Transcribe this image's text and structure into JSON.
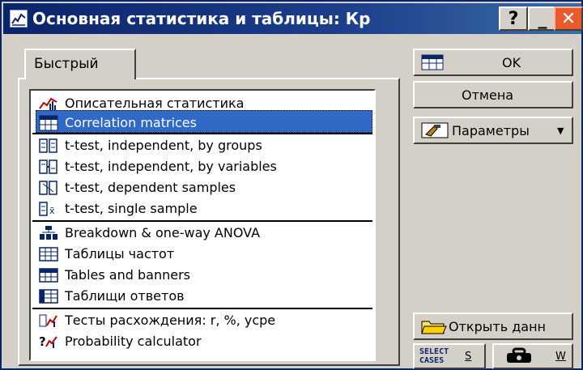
{
  "window": {
    "title": "Основная статистика и таблицы: Кр",
    "help_label": "?",
    "min_label": "_",
    "close_label": "✕"
  },
  "tabs": [
    {
      "label": "Быстрый"
    }
  ],
  "list": {
    "items": [
      {
        "label": "Описательная статистика",
        "icon": "descriptive-stats-icon"
      },
      {
        "label": "Correlation matrices",
        "icon": "correlation-matrix-icon",
        "selected": true
      },
      {
        "label": "t-test, independent, by groups",
        "icon": "ttest-groups-icon"
      },
      {
        "label": "t-test, independent, by variables",
        "icon": "ttest-variables-icon"
      },
      {
        "label": "t-test, dependent samples",
        "icon": "ttest-dependent-icon"
      },
      {
        "label": "t-test, single sample",
        "icon": "ttest-single-icon"
      },
      {
        "label": "Breakdown & one-way ANOVA",
        "icon": "breakdown-anova-icon"
      },
      {
        "label": "Таблицы частот",
        "icon": "frequency-table-icon"
      },
      {
        "label": "Tables and banners",
        "icon": "tables-banners-icon"
      },
      {
        "label": "Таблищи ответов",
        "icon": "response-table-icon"
      },
      {
        "label": "Тесты расхождения: r, %, усре",
        "icon": "difference-tests-icon"
      },
      {
        "label": "Probability calculator",
        "icon": "probability-calculator-icon"
      }
    ]
  },
  "buttons": {
    "ok": "OK",
    "cancel": "Отмена",
    "params": "Параметры",
    "open": "Открыть данн",
    "select_cases": [
      "SELECT",
      "CASES"
    ],
    "select_key": "S",
    "w_key": "W"
  },
  "colors": {
    "title_bar": "#0a246a",
    "selection": "#3169c6",
    "close_button": "#e85a2c"
  }
}
